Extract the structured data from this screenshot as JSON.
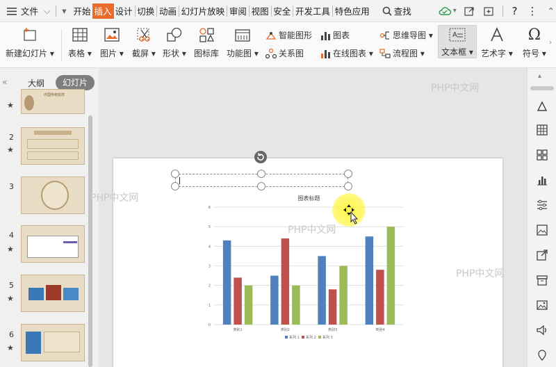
{
  "menu": {
    "file": "文件",
    "tabs": [
      "开始",
      "插入",
      "设计",
      "切换",
      "动画",
      "幻灯片放映",
      "审阅",
      "视图",
      "安全",
      "开发工具",
      "特色应用"
    ],
    "active_tab": "插入",
    "search": "查找"
  },
  "ribbon": {
    "new_slide": "新建幻灯片",
    "table": "表格",
    "picture": "图片",
    "screenshot": "截屏",
    "shape": "形状",
    "icon_lib": "图标库",
    "function_chart": "功能图",
    "smart_graphic": "智能图形",
    "chart": "图表",
    "mind_map": "思维导图",
    "relation_chart": "关系图",
    "online_chart": "在线图表",
    "flowchart": "流程图",
    "textbox": "文本框",
    "art_text": "艺术字",
    "symbol": "符号"
  },
  "panel": {
    "outline_tab": "大纲",
    "slides_tab": "幻灯片",
    "slide_numbers": [
      "2",
      "3",
      "4",
      "5",
      "6"
    ],
    "first_thumb_title": "中国传统纹样"
  },
  "watermarks": [
    "PHP中文网",
    "PHP中文网",
    "PHP中文网",
    "PHP中文网"
  ],
  "chart_data": {
    "type": "bar",
    "title": "图表标题",
    "categories": [
      "类别1",
      "类别2",
      "类别3",
      "类别4"
    ],
    "series": [
      {
        "name": "系列 1",
        "values": [
          4.3,
          2.5,
          3.5,
          4.5
        ],
        "color": "#4f81bd"
      },
      {
        "name": "系列 2",
        "values": [
          2.4,
          4.4,
          1.8,
          2.8
        ],
        "color": "#c0504d"
      },
      {
        "name": "系列 3",
        "values": [
          2,
          2,
          3,
          5
        ],
        "color": "#9bbb59"
      }
    ],
    "ylim": [
      0,
      6
    ],
    "yticks": [
      "0",
      "1",
      "2",
      "3",
      "4",
      "5",
      "6"
    ],
    "grid": true,
    "legend": "bottom"
  }
}
